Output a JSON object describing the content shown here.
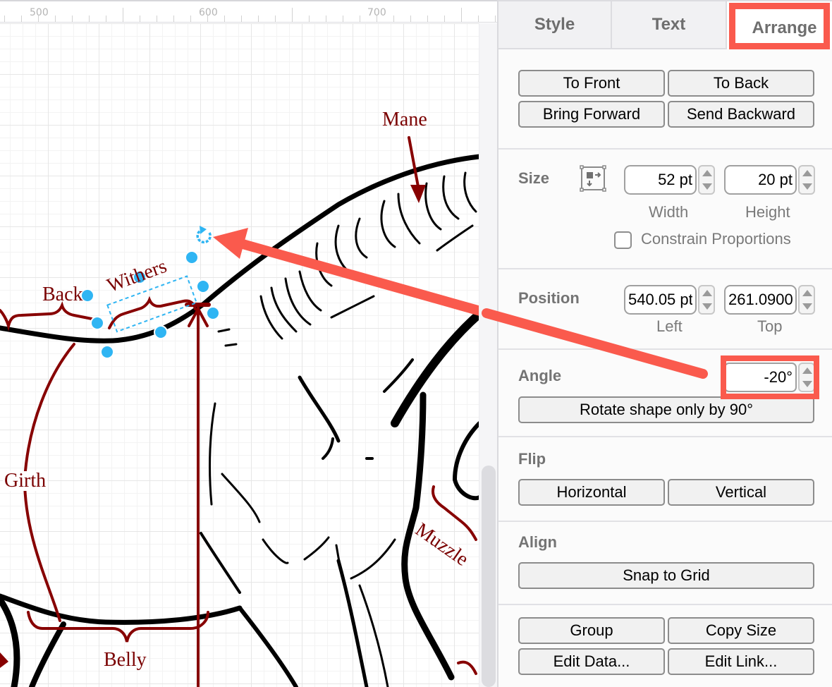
{
  "ruler": {
    "labels": [
      "500",
      "600",
      "700"
    ]
  },
  "diagram": {
    "labels": {
      "mane": "Mane",
      "back": "Back",
      "withers": "Withers",
      "girth": "Girth",
      "belly": "Belly",
      "muzzle": "Muzzle"
    },
    "colors": {
      "label": "#7a0000",
      "selection": "#2fb5f3",
      "annotation_arrow": "#fa5a4d"
    }
  },
  "panel": {
    "tabs": [
      {
        "label": "Style",
        "active": false
      },
      {
        "label": "Text",
        "active": false
      },
      {
        "label": "Arrange",
        "active": true
      }
    ],
    "order_buttons": {
      "to_front": "To Front",
      "to_back": "To Back",
      "bring_forward": "Bring Forward",
      "send_backward": "Send Backward"
    },
    "size": {
      "title": "Size",
      "width_value": "52 pt",
      "height_value": "20 pt",
      "width_label": "Width",
      "height_label": "Height",
      "constrain_label": "Constrain Proportions",
      "constrain_checked": false
    },
    "position": {
      "title": "Position",
      "left_value": "540.05 pt",
      "top_value": "261.0900",
      "left_label": "Left",
      "top_label": "Top"
    },
    "angle": {
      "title": "Angle",
      "value": "-20°",
      "rotate_button": "Rotate shape only by 90°"
    },
    "flip": {
      "title": "Flip",
      "horizontal": "Horizontal",
      "vertical": "Vertical"
    },
    "align": {
      "title": "Align",
      "snap_button": "Snap to Grid"
    },
    "misc_buttons": {
      "group": "Group",
      "copy_size": "Copy Size",
      "edit_data": "Edit Data...",
      "edit_link": "Edit Link..."
    },
    "highlight_color": "#fa5a4d"
  }
}
